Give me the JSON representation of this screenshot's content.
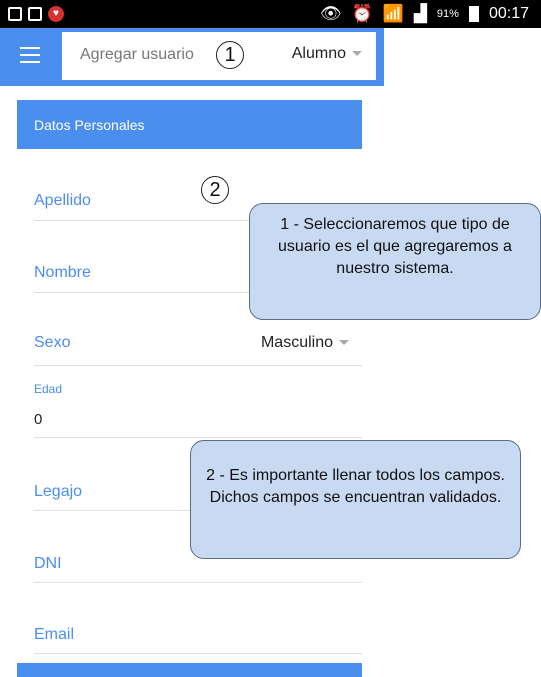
{
  "status_bar": {
    "battery": "91%",
    "time": "00:17"
  },
  "app_bar": {
    "title": "Agregar usuario",
    "user_type": "Alumno"
  },
  "section": {
    "title": "Datos Personales"
  },
  "form": {
    "apellido_label": "Apellido",
    "nombre_label": "Nombre",
    "sexo_label": "Sexo",
    "sexo_value": "Masculino",
    "edad_label": "Edad",
    "edad_value": "0",
    "legajo_label": "Legajo",
    "dni_label": "DNI",
    "email_label": "Email"
  },
  "annotations": {
    "marker1": "1",
    "marker2": "2",
    "tip1": "1 - Seleccionaremos que tipo de usuario es el que agregaremos a nuestro sistema.",
    "tip2": "2 - Es importante llenar todos los campos. Dichos campos se encuentran validados."
  },
  "colors": {
    "primary": "#4a8ef0",
    "tooltip_bg": "#c8d9f2"
  }
}
